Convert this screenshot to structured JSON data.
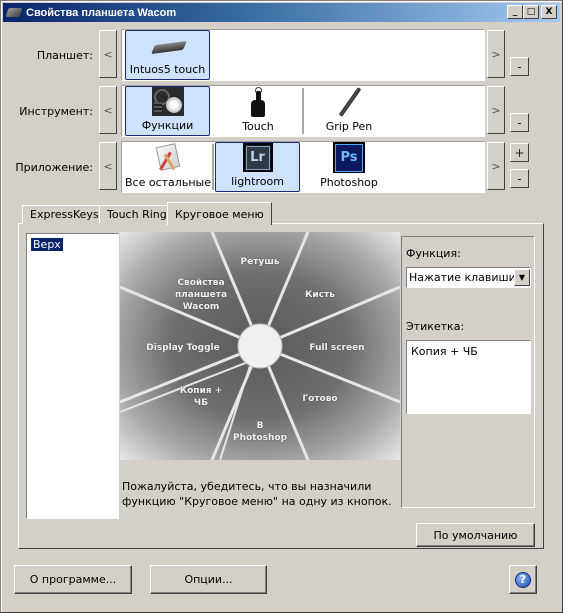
{
  "window": {
    "title": "Свойства планшета Wacom",
    "controls": {
      "minimize": "_",
      "maximize": "□",
      "close": "X"
    }
  },
  "rows": {
    "tablet": {
      "label": "Планшет:",
      "prev": "<",
      "next": ">",
      "remove": "-",
      "items": [
        {
          "label": "Intuos5 touch",
          "icon": "tablet-icon",
          "selected": true
        }
      ]
    },
    "tool": {
      "label": "Инструмент:",
      "prev": "<",
      "next": ">",
      "remove": "-",
      "items": [
        {
          "label": "Функции",
          "icon": "functions-icon",
          "selected": true
        },
        {
          "label": "Touch",
          "icon": "touch-hand-icon",
          "selected": false
        },
        {
          "label": "Grip Pen",
          "icon": "pen-icon",
          "selected": false
        }
      ]
    },
    "application": {
      "label": "Приложение:",
      "prev": "<",
      "next": ">",
      "add": "+",
      "remove": "-",
      "items": [
        {
          "label": "Все остальные",
          "icon": "all-apps-icon",
          "selected": false
        },
        {
          "label": "lightroom",
          "icon": "lightroom-icon",
          "icon_text": "Lr",
          "selected": true
        },
        {
          "label": "Photoshop",
          "icon": "photoshop-icon",
          "icon_text": "Ps",
          "selected": false
        }
      ]
    }
  },
  "tabs": [
    {
      "label": "ExpressKeys",
      "active": false
    },
    {
      "label": "Touch Ring",
      "active": false
    },
    {
      "label": "Круговое меню",
      "active": true
    }
  ],
  "radial_menu": {
    "levels": [
      {
        "label": "Верх",
        "selected": true
      }
    ],
    "segments": [
      "Ретушь",
      "Кисть",
      "Full screen",
      "Готово",
      "В Photoshop",
      "Копия + ЧБ",
      "Display Toggle",
      "Свойства планшета Wacom"
    ],
    "selected_segment": "Копия + ЧБ",
    "hint": "Пожалуйста, убедитесь, что вы назначили функцию \"Круговое меню\" на одну из кнопок.",
    "function_label": "Функция:",
    "function_value": "Нажатие клавиши...",
    "tag_label": "Этикетка:",
    "tag_value": "Копия + ЧБ",
    "default_button": "По умолчанию"
  },
  "footer": {
    "about_button": "О программе...",
    "options_button": "Опции...",
    "help_icon": "?"
  }
}
